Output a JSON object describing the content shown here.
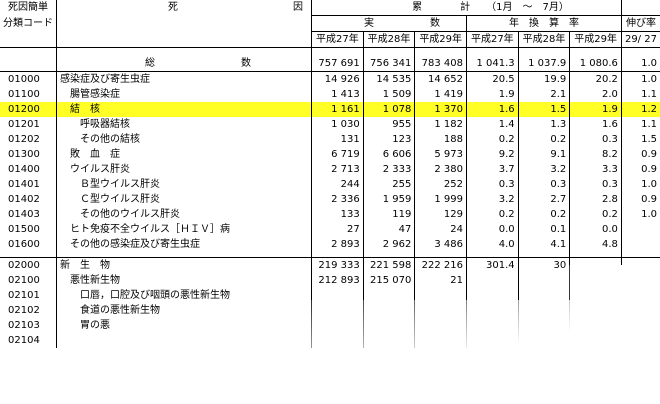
{
  "header": {
    "col_code_line1": "死因簡単",
    "col_code_line2": "分類コード",
    "col_cause_left": "死",
    "col_cause_right": "因",
    "group_cumulative_a": "累",
    "group_cumulative_b": "計",
    "group_period": "（1月　～　7月）",
    "group_count_a": "実",
    "group_count_b": "数",
    "group_rate": "年　換　算　率",
    "group_growth": "伸び率",
    "years": [
      "平成27年",
      "平成28年",
      "平成29年",
      "平成27年",
      "平成28年",
      "平成29年"
    ],
    "growth_sub": "29/ 27"
  },
  "total": {
    "label_a": "総",
    "label_b": "数",
    "values": [
      "757 691",
      "756 341",
      "783 408",
      "1 041.3",
      "1 037.9",
      "1 080.6",
      "1.0"
    ]
  },
  "rows": [
    {
      "code": "01000",
      "cause": "感染症及び寄生虫症",
      "v": [
        "14 926",
        "14 535",
        "14 652",
        "20.5",
        "19.9",
        "20.2",
        "1.0"
      ]
    },
    {
      "code": "01100",
      "cause": "腸管感染症",
      "v": [
        "1 413",
        "1 509",
        "1 419",
        "1.9",
        "2.1",
        "2.0",
        "1.1"
      ]
    },
    {
      "code": "01200",
      "cause": "結　核",
      "v": [
        "1 161",
        "1 078",
        "1 370",
        "1.6",
        "1.5",
        "1.9",
        "1.2"
      ]
    },
    {
      "code": "01201",
      "cause": "呼吸器結核",
      "v": [
        "1 030",
        "955",
        "1 182",
        "1.4",
        "1.3",
        "1.6",
        "1.1"
      ]
    },
    {
      "code": "01202",
      "cause": "その他の結核",
      "v": [
        "131",
        "123",
        "188",
        "0.2",
        "0.2",
        "0.3",
        "1.5"
      ]
    },
    {
      "code": "01300",
      "cause": "敗　血　症",
      "v": [
        "6 719",
        "6 606",
        "5 973",
        "9.2",
        "9.1",
        "8.2",
        "0.9"
      ]
    },
    {
      "code": "01400",
      "cause": "ウイルス肝炎",
      "v": [
        "2 713",
        "2 333",
        "2 380",
        "3.7",
        "3.2",
        "3.3",
        "0.9"
      ]
    },
    {
      "code": "01401",
      "cause": "Ｂ型ウイルス肝炎",
      "v": [
        "244",
        "255",
        "252",
        "0.3",
        "0.3",
        "0.3",
        "1.0"
      ]
    },
    {
      "code": "01402",
      "cause": "Ｃ型ウイルス肝炎",
      "v": [
        "2 336",
        "1 959",
        "1 999",
        "3.2",
        "2.7",
        "2.8",
        "0.9"
      ]
    },
    {
      "code": "01403",
      "cause": "その他のウイルス肝炎",
      "v": [
        "133",
        "119",
        "129",
        "0.2",
        "0.2",
        "0.2",
        "1.0"
      ]
    },
    {
      "code": "01500",
      "cause": "ヒト免疫不全ウイルス［ＨＩＶ］病",
      "v": [
        "27",
        "47",
        "24",
        "0.0",
        "0.1",
        "0.0",
        ""
      ]
    },
    {
      "code": "01600",
      "cause": "その他の感染症及び寄生虫症",
      "v": [
        "2 893",
        "2 962",
        "3 486",
        "4.0",
        "4.1",
        "4.8",
        ""
      ]
    },
    {
      "code": "02000",
      "cause": "新　生　物",
      "v": [
        "219 333",
        "221 598",
        "222 216",
        "301.4",
        "30",
        "",
        ""
      ]
    },
    {
      "code": "02100",
      "cause": "悪性新生物",
      "v": [
        "212 893",
        "215 070",
        "21",
        "",
        "",
        "",
        ""
      ]
    },
    {
      "code": "02101",
      "cause": "口唇，口腔及び咽頭の悪性新生物",
      "v": [
        "",
        "",
        "",
        "",
        "",
        "",
        ""
      ]
    },
    {
      "code": "02102",
      "cause": "食道の悪性新生物",
      "v": [
        "",
        "",
        "",
        "",
        "",
        "",
        ""
      ]
    },
    {
      "code": "02103",
      "cause": "胃の悪",
      "v": [
        "",
        "",
        "",
        "",
        "",
        "",
        ""
      ]
    },
    {
      "code": "02104",
      "cause": "",
      "v": [
        "",
        "",
        "",
        "",
        "",
        "",
        ""
      ]
    }
  ]
}
